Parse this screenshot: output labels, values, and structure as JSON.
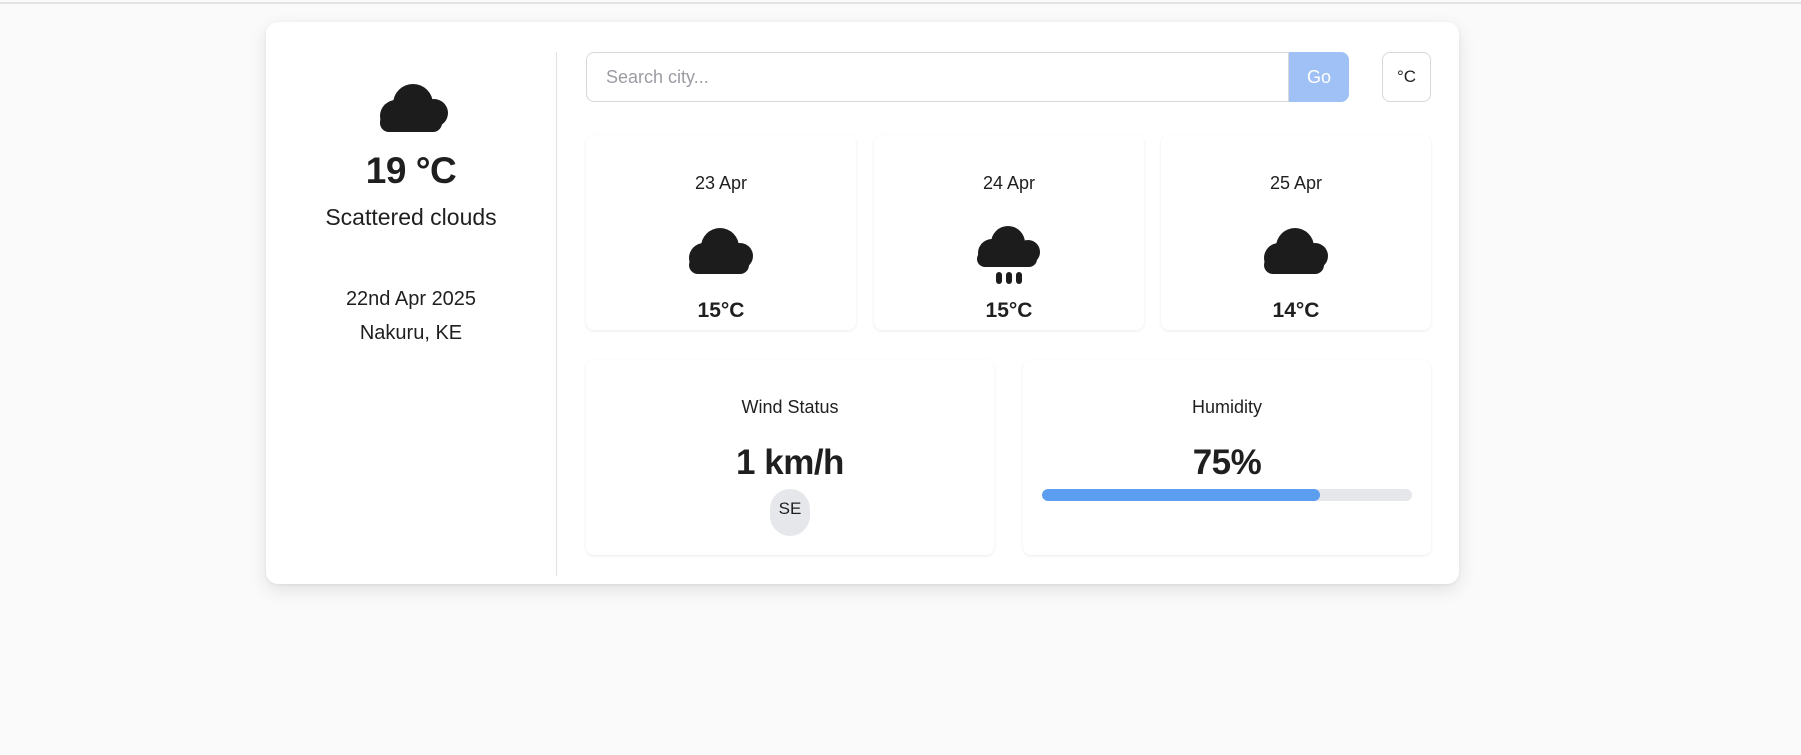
{
  "current": {
    "icon": "cloud-icon",
    "temperature": "19 °C",
    "description": "Scattered clouds",
    "date": "22nd Apr 2025",
    "location": "Nakuru, KE"
  },
  "search": {
    "placeholder": "Search city...",
    "value": "",
    "button_label": "Go"
  },
  "unit_toggle": {
    "label": "°C"
  },
  "forecast": [
    {
      "date": "23 Apr",
      "icon": "cloud-icon",
      "temp": "15°C"
    },
    {
      "date": "24 Apr",
      "icon": "rain-cloud-icon",
      "temp": "15°C"
    },
    {
      "date": "25 Apr",
      "icon": "cloud-icon",
      "temp": "14°C"
    }
  ],
  "highlights": {
    "wind": {
      "title": "Wind Status",
      "value": "1 km/h",
      "direction": "SE"
    },
    "humidity": {
      "title": "Humidity",
      "value": "75%",
      "percent": 75
    }
  },
  "colors": {
    "accent": "#5b9ef0",
    "go_button": "#a0c1f5",
    "track": "#e5e7eb"
  }
}
